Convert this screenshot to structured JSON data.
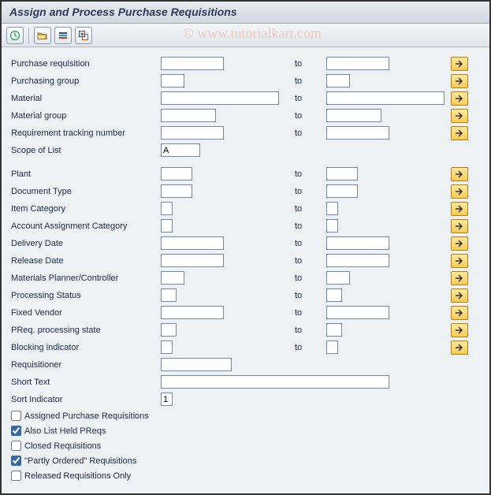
{
  "title": "Assign and Process Purchase Requisitions",
  "watermark": "© www.tutorialkart.com",
  "to_label": "to",
  "fields": {
    "purch_req": {
      "label": "Purchase requisition",
      "from": "",
      "to": "",
      "w_from": 80,
      "w_to": 80,
      "multi": true
    },
    "purch_grp": {
      "label": "Purchasing group",
      "from": "",
      "to": "",
      "w_from": 30,
      "w_to": 30,
      "multi": true
    },
    "material": {
      "label": "Material",
      "from": "",
      "to": "",
      "w_from": 150,
      "w_to": 150,
      "multi": true
    },
    "mat_group": {
      "label": "Material group",
      "from": "",
      "to": "",
      "w_from": 70,
      "w_to": 70,
      "multi": true
    },
    "req_track": {
      "label": "Requirement tracking number",
      "from": "",
      "to": "",
      "w_from": 80,
      "w_to": 80,
      "multi": true
    },
    "scope": {
      "label": "Scope of List",
      "from": "A",
      "to": null,
      "w_from": 50,
      "w_to": 0,
      "multi": false
    },
    "plant": {
      "label": "Plant",
      "from": "",
      "to": "",
      "w_from": 40,
      "w_to": 40,
      "multi": true
    },
    "doc_type": {
      "label": "Document Type",
      "from": "",
      "to": "",
      "w_from": 40,
      "w_to": 40,
      "multi": true
    },
    "item_cat": {
      "label": "Item Category",
      "from": "",
      "to": "",
      "w_from": 15,
      "w_to": 15,
      "multi": true
    },
    "acct_assign": {
      "label": "Account Assignment Category",
      "from": "",
      "to": "",
      "w_from": 15,
      "w_to": 15,
      "multi": true
    },
    "deliv_date": {
      "label": "Delivery Date",
      "from": "",
      "to": "",
      "w_from": 80,
      "w_to": 80,
      "multi": true
    },
    "rel_date": {
      "label": "Release Date",
      "from": "",
      "to": "",
      "w_from": 80,
      "w_to": 80,
      "multi": true
    },
    "mrp_ctrl": {
      "label": "Materials Planner/Controller",
      "from": "",
      "to": "",
      "w_from": 30,
      "w_to": 30,
      "multi": true
    },
    "proc_status": {
      "label": "Processing Status",
      "from": "",
      "to": "",
      "w_from": 20,
      "w_to": 20,
      "multi": true
    },
    "fixed_vend": {
      "label": "Fixed Vendor",
      "from": "",
      "to": "",
      "w_from": 80,
      "w_to": 80,
      "multi": true
    },
    "preq_state": {
      "label": "PReq. processing state",
      "from": "",
      "to": "",
      "w_from": 20,
      "w_to": 20,
      "multi": true
    },
    "block_ind": {
      "label": "Blocking indicator",
      "from": "",
      "to": "",
      "w_from": 15,
      "w_to": 15,
      "multi": true
    },
    "requisitioner": {
      "label": "Requisitioner",
      "from": "",
      "to": null,
      "w_from": 90,
      "w_to": 0,
      "multi": false
    },
    "short_text": {
      "label": "Short Text",
      "from": "",
      "to": null,
      "w_from": 290,
      "w_to": 0,
      "multi": false
    },
    "sort_ind": {
      "label": "Sort Indicator",
      "from": "1",
      "to": null,
      "w_from": 15,
      "w_to": 0,
      "multi": false
    }
  },
  "checkboxes": {
    "assigned": {
      "label": "Assigned Purchase Requisitions",
      "checked": false
    },
    "also_held": {
      "label": "Also List Held PReqs",
      "checked": true
    },
    "closed": {
      "label": "Closed Requisitions",
      "checked": false
    },
    "partly": {
      "label": "\"Partly Ordered\" Requisitions",
      "checked": true
    },
    "released": {
      "label": "Released Requisitions Only",
      "checked": false
    }
  }
}
